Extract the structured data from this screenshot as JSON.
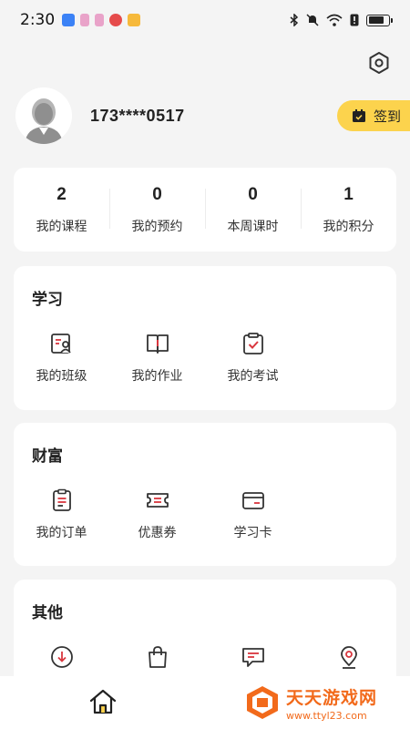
{
  "status_bar": {
    "time": "2:30",
    "battery_level": 0.8
  },
  "profile": {
    "phone": "173****0517",
    "checkin_label": "签到"
  },
  "stats": [
    {
      "value": "2",
      "label": "我的课程"
    },
    {
      "value": "0",
      "label": "我的预约"
    },
    {
      "value": "0",
      "label": "本周课时"
    },
    {
      "value": "1",
      "label": "我的积分"
    }
  ],
  "learning": {
    "title": "学习",
    "items": [
      {
        "label": "我的班级",
        "icon": "class-icon"
      },
      {
        "label": "我的作业",
        "icon": "homework-icon"
      },
      {
        "label": "我的考试",
        "icon": "exam-icon"
      }
    ]
  },
  "wealth": {
    "title": "财富",
    "items": [
      {
        "label": "我的订单",
        "icon": "order-icon"
      },
      {
        "label": "优惠券",
        "icon": "coupon-icon"
      },
      {
        "label": "学习卡",
        "icon": "card-icon"
      }
    ]
  },
  "other": {
    "title": "其他",
    "items": [
      {
        "icon": "download-icon"
      },
      {
        "icon": "bag-icon"
      },
      {
        "icon": "message-icon"
      },
      {
        "icon": "location-icon"
      }
    ]
  },
  "watermark": {
    "title": "天天游戏网",
    "url": "www.ttyl23.com"
  },
  "colors": {
    "accent_yellow": "#fcd34d",
    "icon_red": "#d9363e",
    "watermark_orange": "#f26a1b"
  }
}
